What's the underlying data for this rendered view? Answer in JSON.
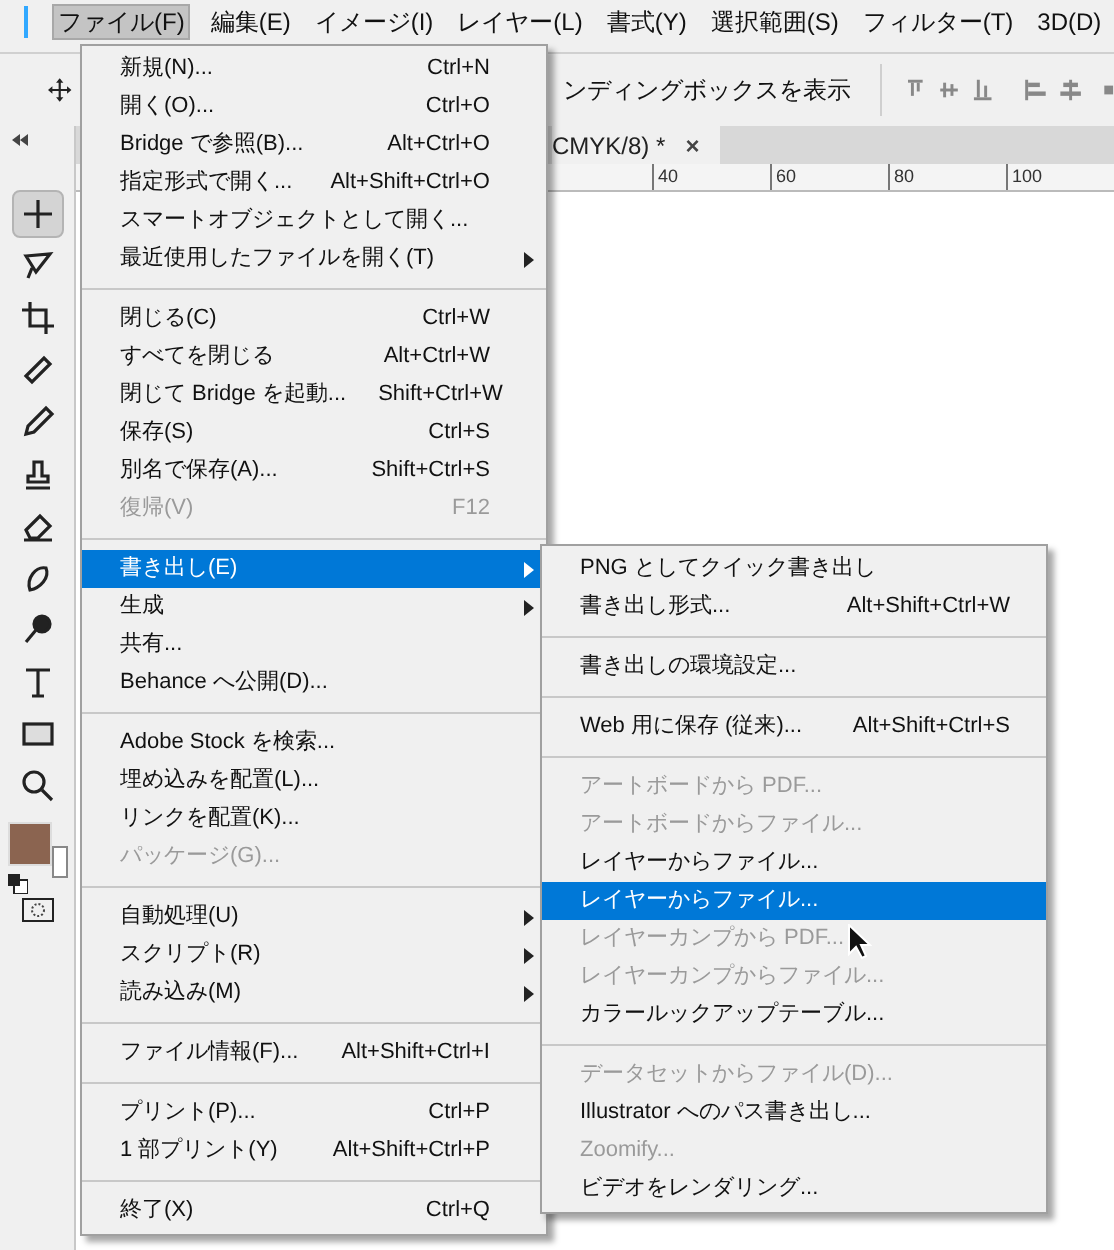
{
  "menu_bar": [
    {
      "label": "ファイル(F)",
      "selected": true
    },
    {
      "label": "編集(E)",
      "selected": false
    },
    {
      "label": "イメージ(I)",
      "selected": false
    },
    {
      "label": "レイヤー(L)",
      "selected": false
    },
    {
      "label": "書式(Y)",
      "selected": false
    },
    {
      "label": "選択範囲(S)",
      "selected": false
    },
    {
      "label": "フィルター(T)",
      "selected": false
    },
    {
      "label": "3D(D)",
      "selected": false
    }
  ],
  "options_bar": {
    "label": "ンディングボックスを表示"
  },
  "document_tab": {
    "title": "CMYK/8) *",
    "close": "×"
  },
  "ruler": {
    "ticks": [
      "40",
      "60",
      "80",
      "100"
    ]
  },
  "file_menu": [
    {
      "kind": "item",
      "label": "新規(N)...",
      "shortcut": "Ctrl+N",
      "submenu": false,
      "disabled": false,
      "selected": false
    },
    {
      "kind": "item",
      "label": "開く(O)...",
      "shortcut": "Ctrl+O",
      "submenu": false,
      "disabled": false,
      "selected": false
    },
    {
      "kind": "item",
      "label": "Bridge で参照(B)...",
      "shortcut": "Alt+Ctrl+O",
      "submenu": false,
      "disabled": false,
      "selected": false
    },
    {
      "kind": "item",
      "label": "指定形式で開く...",
      "shortcut": "Alt+Shift+Ctrl+O",
      "submenu": false,
      "disabled": false,
      "selected": false
    },
    {
      "kind": "item",
      "label": "スマートオブジェクトとして開く...",
      "submenu": false,
      "disabled": false,
      "selected": false
    },
    {
      "kind": "item",
      "label": "最近使用したファイルを開く(T)",
      "submenu": true,
      "disabled": false,
      "selected": false
    },
    {
      "kind": "separator"
    },
    {
      "kind": "item",
      "label": "閉じる(C)",
      "shortcut": "Ctrl+W",
      "submenu": false,
      "disabled": false,
      "selected": false
    },
    {
      "kind": "item",
      "label": "すべてを閉じる",
      "shortcut": "Alt+Ctrl+W",
      "submenu": false,
      "disabled": false,
      "selected": false
    },
    {
      "kind": "item",
      "label": "閉じて Bridge を起動...",
      "shortcut": "Shift+Ctrl+W",
      "submenu": false,
      "disabled": false,
      "selected": false
    },
    {
      "kind": "item",
      "label": "保存(S)",
      "shortcut": "Ctrl+S",
      "submenu": false,
      "disabled": false,
      "selected": false
    },
    {
      "kind": "item",
      "label": "別名で保存(A)...",
      "shortcut": "Shift+Ctrl+S",
      "submenu": false,
      "disabled": false,
      "selected": false
    },
    {
      "kind": "item",
      "label": "復帰(V)",
      "shortcut": "F12",
      "submenu": false,
      "disabled": true,
      "selected": false
    },
    {
      "kind": "separator"
    },
    {
      "kind": "item",
      "label": "書き出し(E)",
      "submenu": true,
      "disabled": false,
      "selected": true
    },
    {
      "kind": "item",
      "label": "生成",
      "submenu": true,
      "disabled": false,
      "selected": false
    },
    {
      "kind": "item",
      "label": "共有...",
      "submenu": false,
      "disabled": false,
      "selected": false
    },
    {
      "kind": "item",
      "label": "Behance へ公開(D)...",
      "submenu": false,
      "disabled": false,
      "selected": false
    },
    {
      "kind": "separator"
    },
    {
      "kind": "item",
      "label": "Adobe Stock を検索...",
      "submenu": false,
      "disabled": false,
      "selected": false
    },
    {
      "kind": "item",
      "label": "埋め込みを配置(L)...",
      "submenu": false,
      "disabled": false,
      "selected": false
    },
    {
      "kind": "item",
      "label": "リンクを配置(K)...",
      "submenu": false,
      "disabled": false,
      "selected": false
    },
    {
      "kind": "item",
      "label": "パッケージ(G)...",
      "submenu": false,
      "disabled": true,
      "selected": false
    },
    {
      "kind": "separator"
    },
    {
      "kind": "item",
      "label": "自動処理(U)",
      "submenu": true,
      "disabled": false,
      "selected": false
    },
    {
      "kind": "item",
      "label": "スクリプト(R)",
      "submenu": true,
      "disabled": false,
      "selected": false
    },
    {
      "kind": "item",
      "label": "読み込み(M)",
      "submenu": true,
      "disabled": false,
      "selected": false
    },
    {
      "kind": "separator"
    },
    {
      "kind": "item",
      "label": "ファイル情報(F)...",
      "shortcut": "Alt+Shift+Ctrl+I",
      "submenu": false,
      "disabled": false,
      "selected": false
    },
    {
      "kind": "separator"
    },
    {
      "kind": "item",
      "label": "プリント(P)...",
      "shortcut": "Ctrl+P",
      "submenu": false,
      "disabled": false,
      "selected": false
    },
    {
      "kind": "item",
      "label": "1 部プリント(Y)",
      "shortcut": "Alt+Shift+Ctrl+P",
      "submenu": false,
      "disabled": false,
      "selected": false
    },
    {
      "kind": "separator"
    },
    {
      "kind": "item",
      "label": "終了(X)",
      "shortcut": "Ctrl+Q",
      "submenu": false,
      "disabled": false,
      "selected": false
    }
  ],
  "export_submenu": [
    {
      "kind": "item",
      "label": "PNG としてクイック書き出し",
      "disabled": false,
      "selected": false
    },
    {
      "kind": "item",
      "label": "書き出し形式...",
      "shortcut": "Alt+Shift+Ctrl+W",
      "disabled": false,
      "selected": false
    },
    {
      "kind": "separator"
    },
    {
      "kind": "item",
      "label": "書き出しの環境設定...",
      "disabled": false,
      "selected": false
    },
    {
      "kind": "separator"
    },
    {
      "kind": "item",
      "label": "Web 用に保存 (従来)...",
      "shortcut": "Alt+Shift+Ctrl+S",
      "disabled": false,
      "selected": false
    },
    {
      "kind": "separator"
    },
    {
      "kind": "item",
      "label": "アートボードから PDF...",
      "disabled": true,
      "selected": false
    },
    {
      "kind": "item",
      "label": "アートボードからファイル...",
      "disabled": true,
      "selected": false
    },
    {
      "kind": "item",
      "label": "レイヤーからファイル...",
      "disabled": false,
      "selected": false
    },
    {
      "kind": "item",
      "label": "レイヤーからファイル...",
      "disabled": false,
      "selected": true
    },
    {
      "kind": "item",
      "label": "レイヤーカンプから PDF...",
      "disabled": true,
      "selected": false
    },
    {
      "kind": "item",
      "label": "レイヤーカンプからファイル...",
      "disabled": true,
      "selected": false
    },
    {
      "kind": "item",
      "label": "カラールックアップテーブル...",
      "disabled": false,
      "selected": false
    },
    {
      "kind": "separator"
    },
    {
      "kind": "item",
      "label": "データセットからファイル(D)...",
      "disabled": true,
      "selected": false
    },
    {
      "kind": "item",
      "label": "Illustrator へのパス書き出し...",
      "disabled": false,
      "selected": false
    },
    {
      "kind": "item",
      "label": "Zoomify...",
      "disabled": true,
      "selected": false
    },
    {
      "kind": "item",
      "label": "ビデオをレンダリング...",
      "disabled": false,
      "selected": false
    }
  ]
}
